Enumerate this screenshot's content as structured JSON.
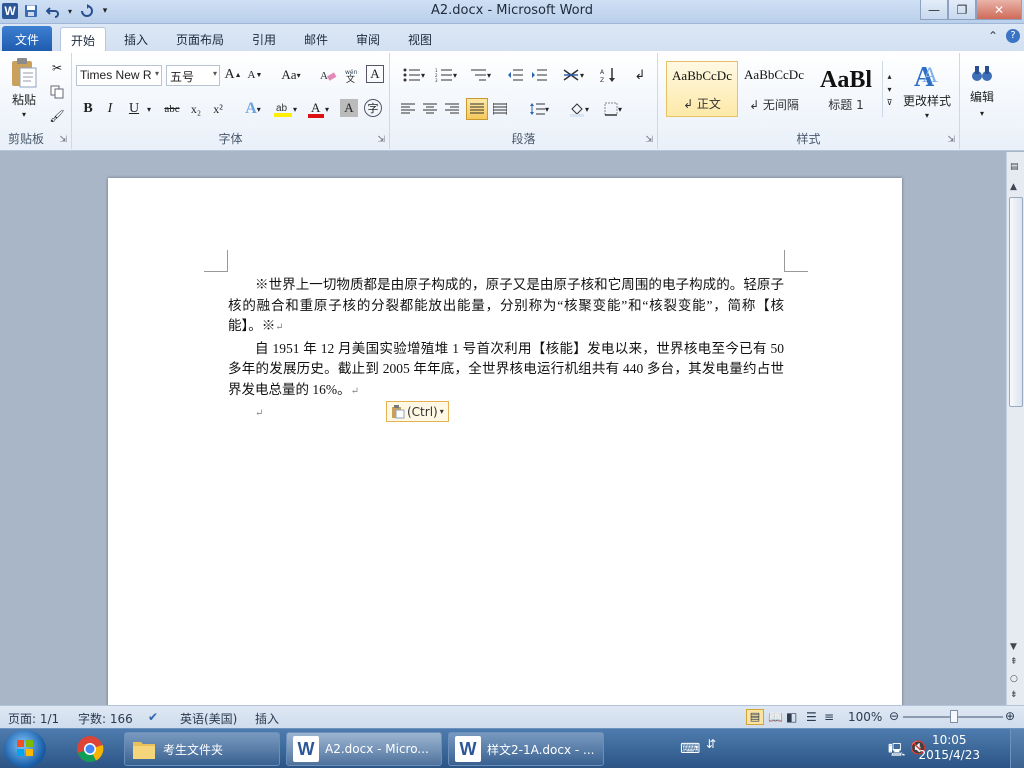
{
  "window": {
    "title": "A2.docx - Microsoft Word",
    "app_logo": "W"
  },
  "quick_access": {
    "save_icon": "save-icon",
    "undo_icon": "undo-icon",
    "redo_icon": "redo-icon"
  },
  "tabs": [
    {
      "label": "文件"
    },
    {
      "label": "开始"
    },
    {
      "label": "插入"
    },
    {
      "label": "页面布局"
    },
    {
      "label": "引用"
    },
    {
      "label": "邮件"
    },
    {
      "label": "审阅"
    },
    {
      "label": "视图"
    }
  ],
  "ribbon": {
    "clipboard": {
      "label": "剪贴板",
      "paste": "粘贴"
    },
    "font": {
      "label": "字体",
      "font_name": "Times New R",
      "font_size": "五号",
      "grow": "A",
      "shrink": "A",
      "change_case": "Aa",
      "bold": "B",
      "italic": "I",
      "underline": "U",
      "strike": "abc",
      "subscript": "x₂",
      "superscript": "x²"
    },
    "paragraph": {
      "label": "段落"
    },
    "styles": {
      "label": "样式",
      "items": [
        {
          "preview": "AaBbCcDc",
          "name": "↲ 正文"
        },
        {
          "preview": "AaBbCcDc",
          "name": "↲ 无间隔"
        },
        {
          "preview": "AaBl",
          "name": "标题 1"
        }
      ],
      "change_styles": "更改样式"
    },
    "editing": {
      "label": "编辑"
    }
  },
  "document": {
    "paragraphs": [
      "※世界上一切物质都是由原子构成的，原子又是由原子核和它周围的电子构成的。轻原子核的融合和重原子核的分裂都能放出能量，分别称为“核聚变能”和“核裂变能”，简称【核能】。※",
      "自 1951 年 12 月美国实验增殖堆 1 号首次利用【核能】发电以来，世界核电至今已有 50 多年的发展历史。截止到 2005 年年底，全世界核电运行机组共有 440 多台，其发电量约占世界发电总量的 16%。"
    ],
    "paragraph_mark": "↵",
    "paste_options": "(Ctrl)"
  },
  "status": {
    "page": "页面: 1/1",
    "words": "字数: 166",
    "language": "英语(美国)",
    "mode": "插入",
    "zoom": "100%"
  },
  "taskbar": {
    "items": [
      {
        "label": "考生文件夹"
      },
      {
        "label": "A2.docx - Micro..."
      },
      {
        "label": "样文2-1A.docx - ..."
      }
    ],
    "time": "10:05",
    "date": "2015/4/23"
  }
}
